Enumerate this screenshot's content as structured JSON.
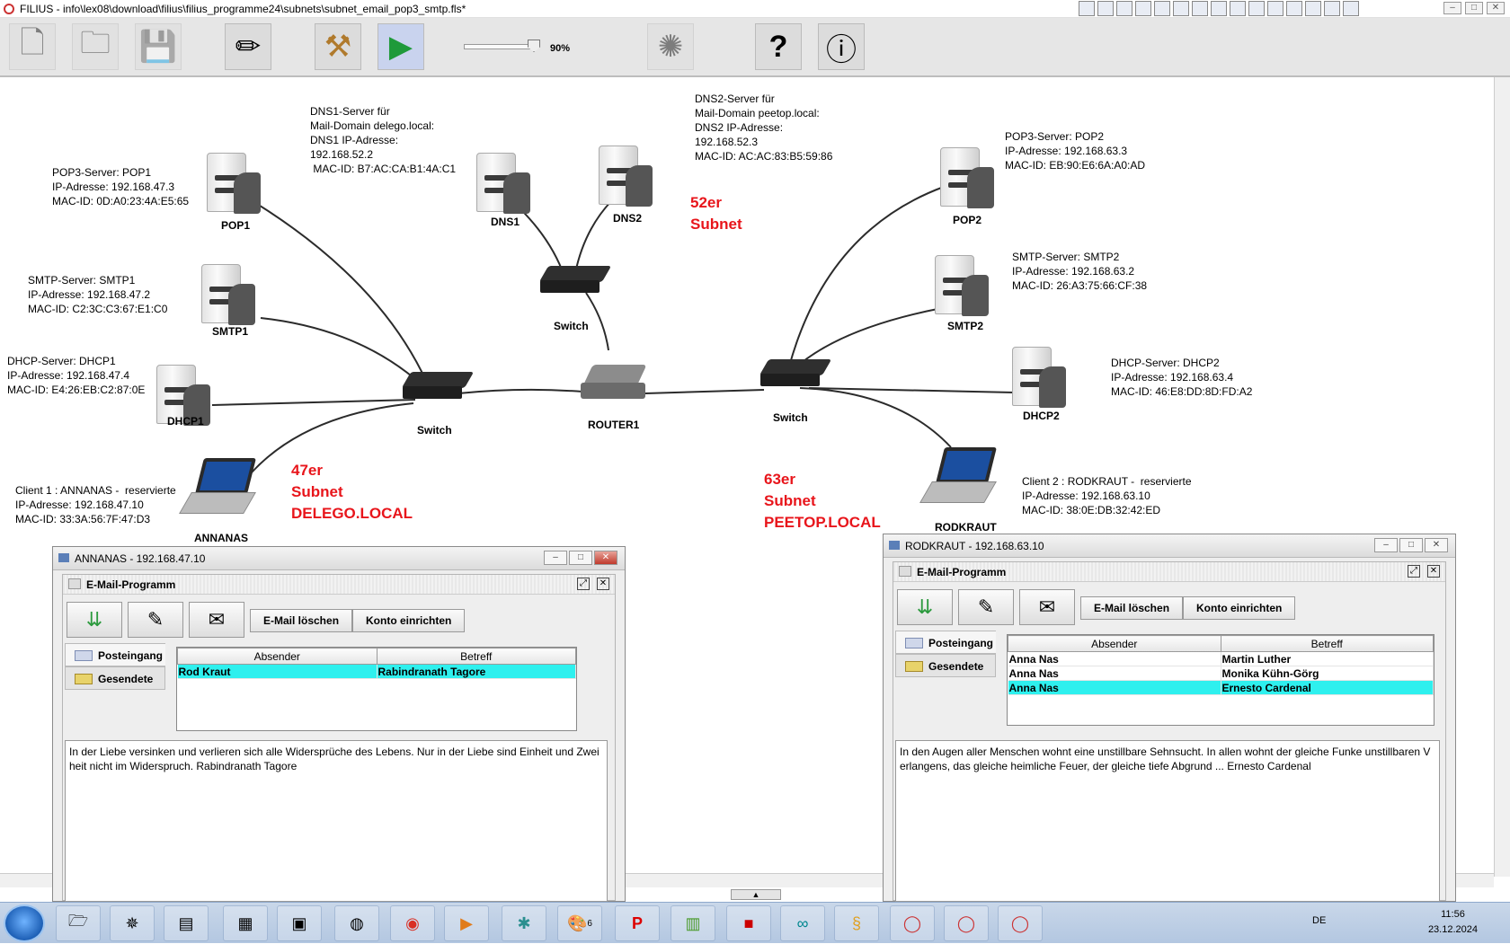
{
  "window": {
    "title": "FILIUS - info\\lex08\\download\\filius\\filius_programme24\\subnets\\subnet_email_pop3_smtp.fls*"
  },
  "toolbar": {
    "zoom_label": "90%",
    "zoom_level_percent": 90,
    "buttons": [
      "new-icon",
      "open-icon",
      "save-icon",
      "pencil-icon",
      "hammer-icon",
      "play-icon",
      "wizard-icon",
      "help-icon",
      "info-icon"
    ]
  },
  "network": {
    "pop1_label": "POP1",
    "pop1_info": "POP3-Server: POP1\nIP-Adresse: 192.168.47.3\nMAC-ID: 0D:A0:23:4A:E5:65",
    "smtp1_label": "SMTP1",
    "smtp1_info": "SMTP-Server: SMTP1\nIP-Adresse: 192.168.47.2\nMAC-ID: C2:3C:C3:67:E1:C0",
    "dhcp1_label": "DHCP1",
    "dhcp1_info": "DHCP-Server: DHCP1\nIP-Adresse: 192.168.47.4\nMAC-ID: E4:26:EB:C2:87:0E",
    "annanas_label": "ANNANAS",
    "annanas_info": "Client 1 : ANNANAS -  reservierte\nIP-Adresse: 192.168.47.10\nMAC-ID: 33:3A:56:7F:47:D3",
    "dns1_label": "DNS1",
    "dns1_info": "DNS1-Server für\nMail-Domain delego.local:\nDNS1 IP-Adresse:\n192.168.52.2\n MAC-ID: B7:AC:CA:B1:4A:C1",
    "dns2_label": "DNS2",
    "dns2_info": "DNS2-Server für\nMail-Domain peetop.local:\nDNS2 IP-Adresse:\n192.168.52.3\nMAC-ID: AC:AC:83:B5:59:86",
    "switch_label": "Switch",
    "router_label": "ROUTER1",
    "pop2_label": "POP2",
    "pop2_info": "POP3-Server: POP2\nIP-Adresse: 192.168.63.3\nMAC-ID: EB:90:E6:6A:A0:AD",
    "smtp2_label": "SMTP2",
    "smtp2_info": "SMTP-Server: SMTP2\nIP-Adresse: 192.168.63.2\nMAC-ID: 26:A3:75:66:CF:38",
    "dhcp2_label": "DHCP2",
    "dhcp2_info": "DHCP-Server: DHCP2\nIP-Adresse: 192.168.63.4\nMAC-ID: 46:E8:DD:8D:FD:A2",
    "rodkraut_label": "RODKRAUT",
    "rodkraut_info": "Client 2 : RODKRAUT -  reservierte\nIP-Adresse: 192.168.63.10\nMAC-ID: 38:0E:DB:32:42:ED",
    "subnet47": "47er\nSubnet\nDELEGO.LOCAL",
    "subnet52": "52er\nSubnet",
    "subnet63": "63er\nSubnet\nPEETOP.LOCAL",
    "accent_color": "#e8151b"
  },
  "annanas_window": {
    "title": "ANNANAS - 192.168.47.10",
    "inner_title": "E-Mail-Programm",
    "delete_button": "E-Mail löschen",
    "account_button": "Konto einrichten",
    "tab_inbox": "Posteingang",
    "tab_sent": "Gesendete",
    "col_sender": "Absender",
    "col_subject": "Betreff",
    "rows": [
      {
        "sender": "Rod Kraut",
        "subject": "Rabindranath Tagore",
        "selected": true
      }
    ],
    "message": "In der Liebe versinken und verlieren sich alle Widersprüche des Lebens. Nur in der Liebe sind Einheit und Zweiheit nicht im Widerspruch. Rabindranath Tagore"
  },
  "rodkraut_window": {
    "title": "RODKRAUT - 192.168.63.10",
    "inner_title": "E-Mail-Programm",
    "delete_button": "E-Mail löschen",
    "account_button": "Konto einrichten",
    "tab_inbox": "Posteingang",
    "tab_sent": "Gesendete",
    "col_sender": "Absender",
    "col_subject": "Betreff",
    "rows": [
      {
        "sender": "Anna Nas",
        "subject": "Martin Luther",
        "selected": false
      },
      {
        "sender": "Anna Nas",
        "subject": "Monika Kühn-Görg",
        "selected": false
      },
      {
        "sender": "Anna Nas",
        "subject": "Ernesto Cardenal",
        "selected": true
      }
    ],
    "message": "In den Augen aller Menschen wohnt eine unstillbare Sehnsucht. In allen wohnt der gleiche Funke unstillbaren Verlangens, das gleiche heimliche Feuer, der gleiche tiefe Abgrund ... Ernesto Cardenal"
  },
  "taskbar": {
    "lang": "DE",
    "time": "11:56",
    "date": "23.12.2024",
    "badge6": "6"
  }
}
